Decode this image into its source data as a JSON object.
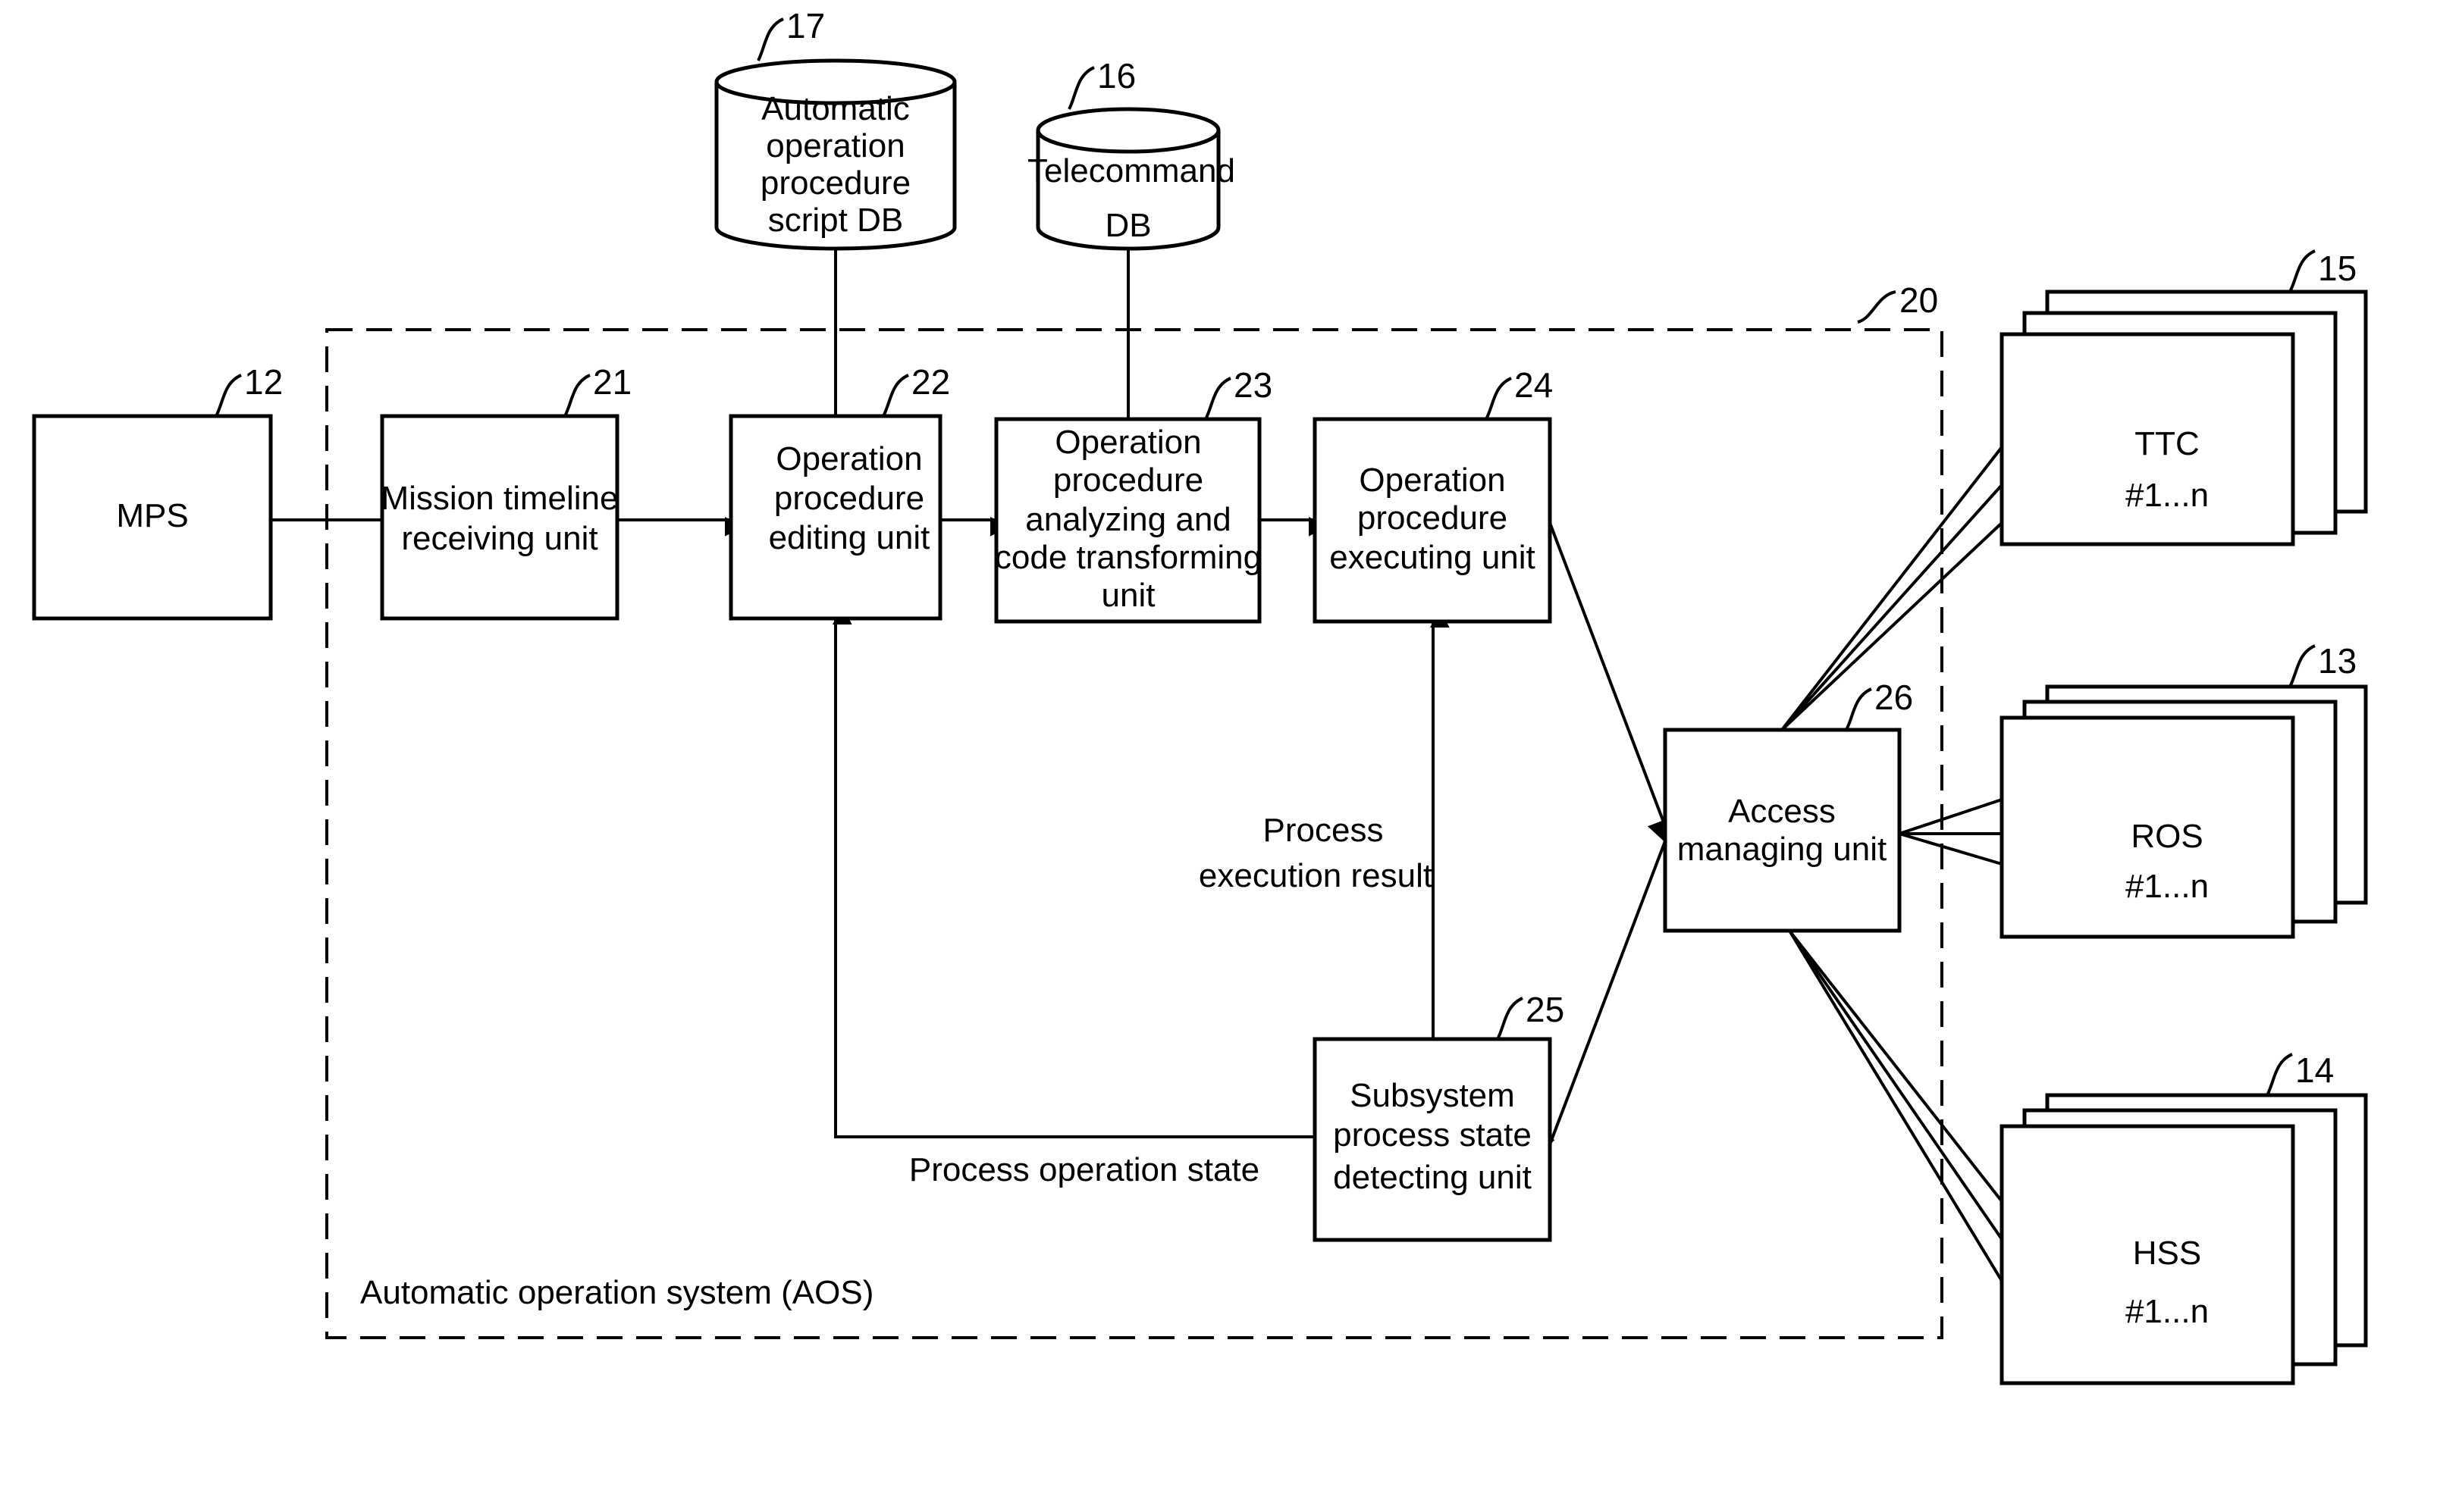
{
  "diagram": {
    "system_label": "Automatic operation system (AOS)",
    "system_ref": "20",
    "nodes": {
      "mps": {
        "ref": "12",
        "lines": [
          "MPS"
        ]
      },
      "mission_timeline": {
        "ref": "21",
        "lines": [
          "Mission timeline",
          "receiving unit"
        ]
      },
      "editing": {
        "ref": "22",
        "lines": [
          "Operation",
          "procedure",
          "editing unit"
        ]
      },
      "analyzing": {
        "ref": "23",
        "lines": [
          "Operation",
          "procedure",
          "analyzing and",
          "code transforming",
          "unit"
        ]
      },
      "executing": {
        "ref": "24",
        "lines": [
          "Operation",
          "procedure",
          "executing unit"
        ]
      },
      "detecting": {
        "ref": "25",
        "lines": [
          "Subsystem",
          "process state",
          "detecting unit"
        ]
      },
      "access": {
        "ref": "26",
        "lines": [
          "Access",
          "managing unit"
        ]
      },
      "script_db": {
        "ref": "17",
        "lines": [
          "Automatic",
          "operation",
          "procedure",
          "script DB"
        ]
      },
      "telecommand_db": {
        "ref": "16",
        "lines": [
          "Telecommand",
          "DB"
        ]
      },
      "ttc": {
        "ref": "15",
        "lines": [
          "TTC",
          "#1...n"
        ]
      },
      "ros": {
        "ref": "13",
        "lines": [
          "ROS",
          "#1...n"
        ]
      },
      "hss": {
        "ref": "14",
        "lines": [
          "HSS",
          "#1...n"
        ]
      }
    },
    "edge_labels": {
      "execution_result": [
        "Process",
        "execution result"
      ],
      "operation_state": "Process operation state"
    }
  }
}
